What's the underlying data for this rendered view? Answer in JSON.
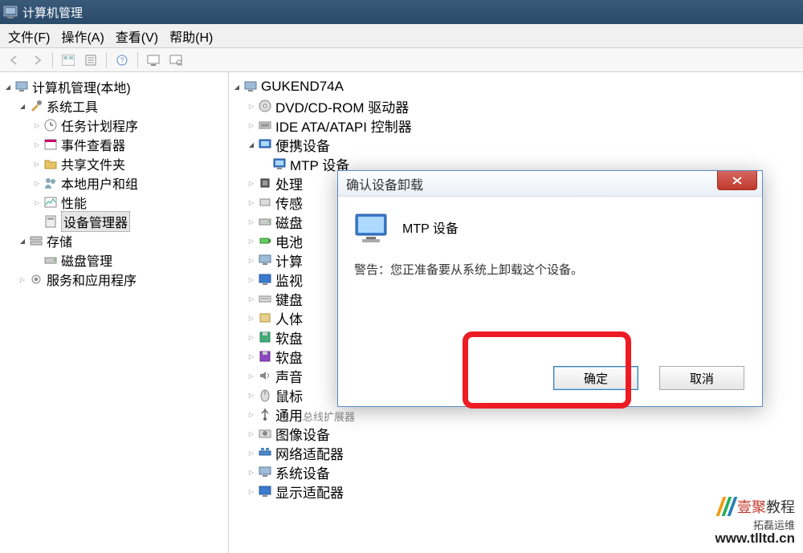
{
  "window": {
    "title": "计算机管理"
  },
  "menu": {
    "file": "文件(F)",
    "action": "操作(A)",
    "view": "查看(V)",
    "help": "帮助(H)"
  },
  "sidebar": {
    "root": "计算机管理(本地)",
    "system_tools": "系统工具",
    "task_scheduler": "任务计划程序",
    "event_viewer": "事件查看器",
    "shared_folders": "共享文件夹",
    "local_users": "本地用户和组",
    "performance": "性能",
    "device_manager": "设备管理器",
    "storage": "存储",
    "disk_management": "磁盘管理",
    "services_apps": "服务和应用程序"
  },
  "tree": {
    "root": "GUKEND74A",
    "dvd": "DVD/CD-ROM 驱动器",
    "ide": "IDE ATA/ATAPI 控制器",
    "portable": "便携设备",
    "mtp": "MTP 设备",
    "processor": "处理",
    "sensor": "传感",
    "disk": "磁盘",
    "battery": "电池",
    "computer": "计算",
    "monitor": "监视",
    "keyboard": "键盘",
    "hid": "人体",
    "floppy1": "软盘",
    "floppy2": "软盘",
    "sound": "声音",
    "mouse": "鼠标",
    "usb": "通用",
    "usb_tail": "总线扩展器",
    "image": "图像设备",
    "network": "网络适配器",
    "system": "系统设备",
    "display": "显示适配器"
  },
  "dialog": {
    "title": "确认设备卸载",
    "device": "MTP 设备",
    "warn": "警告：您正准备要从系统上卸载这个设备。",
    "ok": "确定",
    "cancel": "取消"
  },
  "watermark": {
    "brand1": "壹聚",
    "brand2": "教程",
    "sub": "拓磊运维",
    "url": "www.tlltd.cn"
  }
}
